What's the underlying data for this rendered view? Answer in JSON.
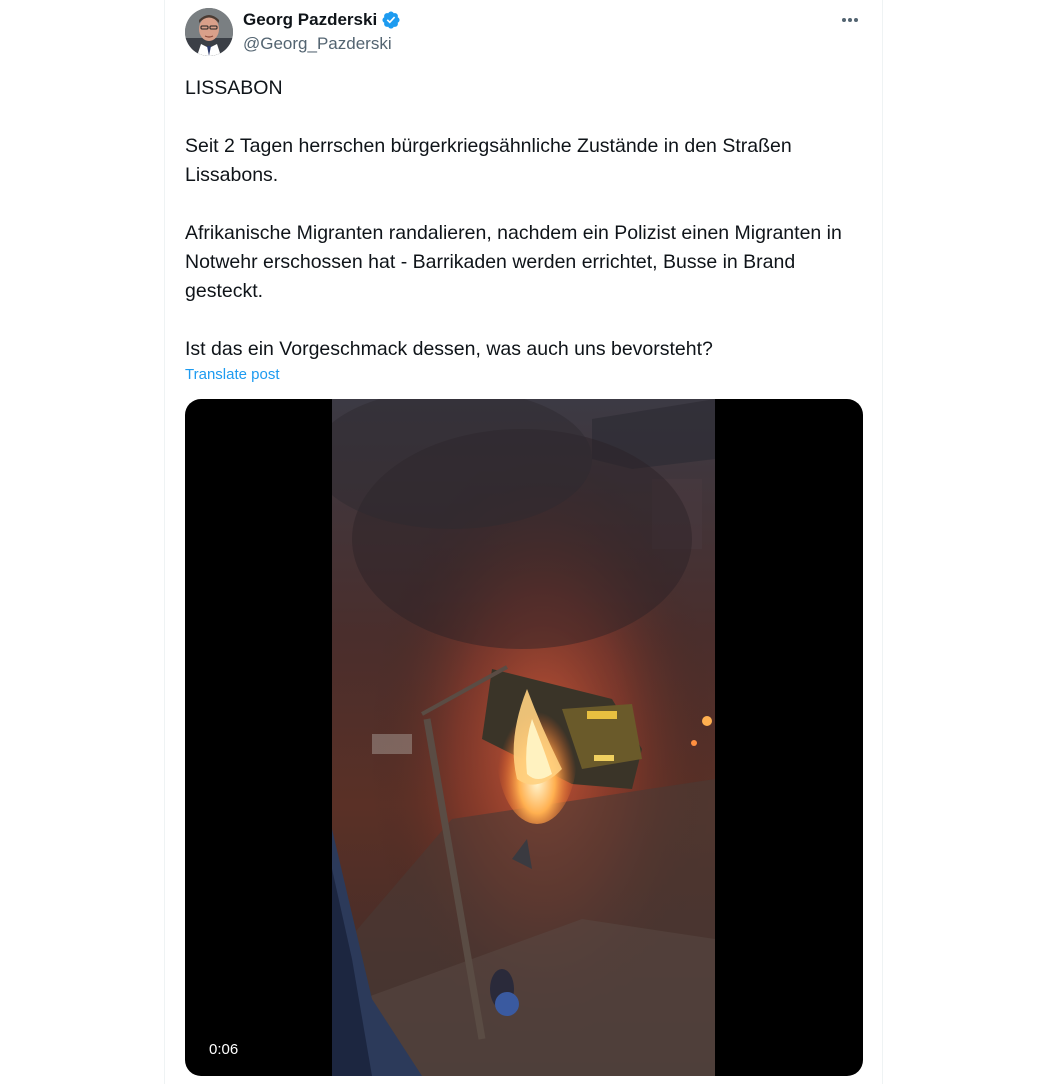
{
  "author": {
    "display_name": "Georg Pazderski",
    "handle": "@Georg_Pazderski",
    "verified": true
  },
  "tweet": {
    "paragraphs": [
      "LISSABON",
      "Seit 2 Tagen herrschen bürgerkriegsähnliche Zustände in den Straßen Lissabons.",
      "Afrikanische Migranten randalieren, nachdem ein Polizist einen Migranten in Notwehr erschossen hat - Barrikaden werden errichtet, Busse in Brand gesteckt.",
      "Ist das ein Vorgeschmack dessen, was auch uns bevorsteht?"
    ],
    "translate_label": "Translate post"
  },
  "media": {
    "type": "video",
    "timestamp": "0:06"
  },
  "icons": {
    "more": "more-horizontal-icon",
    "verified": "verified-badge-icon"
  },
  "colors": {
    "accent": "#1d9bf0",
    "text_primary": "#0f1419",
    "text_secondary": "#536471"
  }
}
